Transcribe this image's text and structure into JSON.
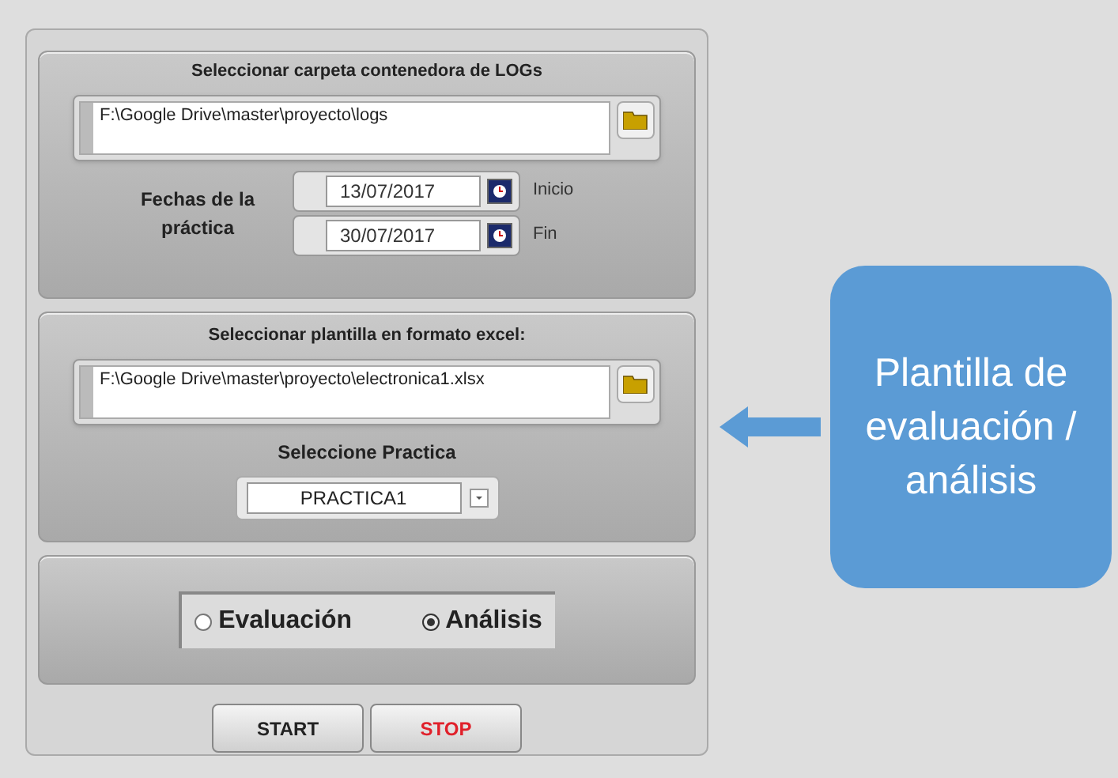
{
  "logs_section": {
    "title": "Seleccionar carpeta contenedora de LOGs",
    "path": "F:\\Google Drive\\master\\proyecto\\logs"
  },
  "dates": {
    "label": "Fechas de la práctica",
    "fields": [
      {
        "value": "13/07/2017",
        "caption": "Inicio"
      },
      {
        "value": "30/07/2017",
        "caption": "Fin"
      }
    ]
  },
  "template_section": {
    "title": "Seleccionar plantilla en formato excel:",
    "path": "F:\\Google Drive\\master\\proyecto\\electronica1.xlsx",
    "practice_label": "Seleccione Practica",
    "practice_value": "PRACTICA1"
  },
  "mode": [
    {
      "label": "Evaluación",
      "selected": false
    },
    {
      "label": "Análisis",
      "selected": true
    }
  ],
  "buttons": [
    {
      "label": "START",
      "kind": "start"
    },
    {
      "label": "STOP",
      "kind": "stop"
    }
  ],
  "callout": {
    "text": "Plantilla de evaluación / análisis"
  }
}
